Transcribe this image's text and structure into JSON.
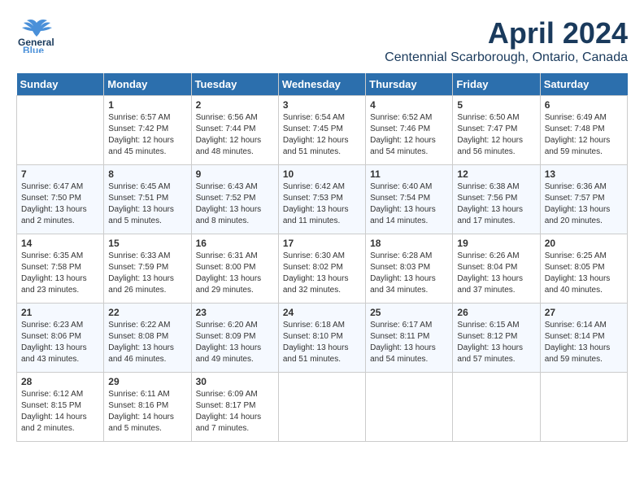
{
  "header": {
    "logo_line1": "General",
    "logo_line2": "Blue",
    "title": "April 2024",
    "subtitle": "Centennial Scarborough, Ontario, Canada"
  },
  "days_of_week": [
    "Sunday",
    "Monday",
    "Tuesday",
    "Wednesday",
    "Thursday",
    "Friday",
    "Saturday"
  ],
  "weeks": [
    [
      {
        "day": "",
        "info": ""
      },
      {
        "day": "1",
        "info": "Sunrise: 6:57 AM\nSunset: 7:42 PM\nDaylight: 12 hours\nand 45 minutes."
      },
      {
        "day": "2",
        "info": "Sunrise: 6:56 AM\nSunset: 7:44 PM\nDaylight: 12 hours\nand 48 minutes."
      },
      {
        "day": "3",
        "info": "Sunrise: 6:54 AM\nSunset: 7:45 PM\nDaylight: 12 hours\nand 51 minutes."
      },
      {
        "day": "4",
        "info": "Sunrise: 6:52 AM\nSunset: 7:46 PM\nDaylight: 12 hours\nand 54 minutes."
      },
      {
        "day": "5",
        "info": "Sunrise: 6:50 AM\nSunset: 7:47 PM\nDaylight: 12 hours\nand 56 minutes."
      },
      {
        "day": "6",
        "info": "Sunrise: 6:49 AM\nSunset: 7:48 PM\nDaylight: 12 hours\nand 59 minutes."
      }
    ],
    [
      {
        "day": "7",
        "info": "Sunrise: 6:47 AM\nSunset: 7:50 PM\nDaylight: 13 hours\nand 2 minutes."
      },
      {
        "day": "8",
        "info": "Sunrise: 6:45 AM\nSunset: 7:51 PM\nDaylight: 13 hours\nand 5 minutes."
      },
      {
        "day": "9",
        "info": "Sunrise: 6:43 AM\nSunset: 7:52 PM\nDaylight: 13 hours\nand 8 minutes."
      },
      {
        "day": "10",
        "info": "Sunrise: 6:42 AM\nSunset: 7:53 PM\nDaylight: 13 hours\nand 11 minutes."
      },
      {
        "day": "11",
        "info": "Sunrise: 6:40 AM\nSunset: 7:54 PM\nDaylight: 13 hours\nand 14 minutes."
      },
      {
        "day": "12",
        "info": "Sunrise: 6:38 AM\nSunset: 7:56 PM\nDaylight: 13 hours\nand 17 minutes."
      },
      {
        "day": "13",
        "info": "Sunrise: 6:36 AM\nSunset: 7:57 PM\nDaylight: 13 hours\nand 20 minutes."
      }
    ],
    [
      {
        "day": "14",
        "info": "Sunrise: 6:35 AM\nSunset: 7:58 PM\nDaylight: 13 hours\nand 23 minutes."
      },
      {
        "day": "15",
        "info": "Sunrise: 6:33 AM\nSunset: 7:59 PM\nDaylight: 13 hours\nand 26 minutes."
      },
      {
        "day": "16",
        "info": "Sunrise: 6:31 AM\nSunset: 8:00 PM\nDaylight: 13 hours\nand 29 minutes."
      },
      {
        "day": "17",
        "info": "Sunrise: 6:30 AM\nSunset: 8:02 PM\nDaylight: 13 hours\nand 32 minutes."
      },
      {
        "day": "18",
        "info": "Sunrise: 6:28 AM\nSunset: 8:03 PM\nDaylight: 13 hours\nand 34 minutes."
      },
      {
        "day": "19",
        "info": "Sunrise: 6:26 AM\nSunset: 8:04 PM\nDaylight: 13 hours\nand 37 minutes."
      },
      {
        "day": "20",
        "info": "Sunrise: 6:25 AM\nSunset: 8:05 PM\nDaylight: 13 hours\nand 40 minutes."
      }
    ],
    [
      {
        "day": "21",
        "info": "Sunrise: 6:23 AM\nSunset: 8:06 PM\nDaylight: 13 hours\nand 43 minutes."
      },
      {
        "day": "22",
        "info": "Sunrise: 6:22 AM\nSunset: 8:08 PM\nDaylight: 13 hours\nand 46 minutes."
      },
      {
        "day": "23",
        "info": "Sunrise: 6:20 AM\nSunset: 8:09 PM\nDaylight: 13 hours\nand 49 minutes."
      },
      {
        "day": "24",
        "info": "Sunrise: 6:18 AM\nSunset: 8:10 PM\nDaylight: 13 hours\nand 51 minutes."
      },
      {
        "day": "25",
        "info": "Sunrise: 6:17 AM\nSunset: 8:11 PM\nDaylight: 13 hours\nand 54 minutes."
      },
      {
        "day": "26",
        "info": "Sunrise: 6:15 AM\nSunset: 8:12 PM\nDaylight: 13 hours\nand 57 minutes."
      },
      {
        "day": "27",
        "info": "Sunrise: 6:14 AM\nSunset: 8:14 PM\nDaylight: 13 hours\nand 59 minutes."
      }
    ],
    [
      {
        "day": "28",
        "info": "Sunrise: 6:12 AM\nSunset: 8:15 PM\nDaylight: 14 hours\nand 2 minutes."
      },
      {
        "day": "29",
        "info": "Sunrise: 6:11 AM\nSunset: 8:16 PM\nDaylight: 14 hours\nand 5 minutes."
      },
      {
        "day": "30",
        "info": "Sunrise: 6:09 AM\nSunset: 8:17 PM\nDaylight: 14 hours\nand 7 minutes."
      },
      {
        "day": "",
        "info": ""
      },
      {
        "day": "",
        "info": ""
      },
      {
        "day": "",
        "info": ""
      },
      {
        "day": "",
        "info": ""
      }
    ]
  ]
}
